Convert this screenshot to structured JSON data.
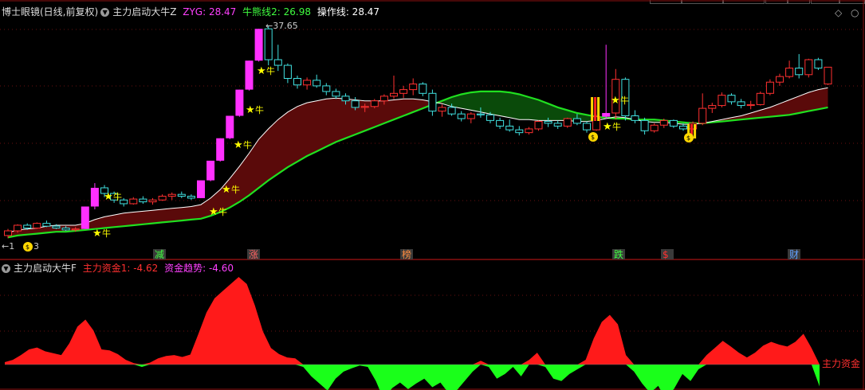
{
  "main_header": {
    "panel_title": "博士眼镜(日线,前复权)",
    "indicator_name": "主力启动大牛Z",
    "zyg_label": "ZYG: 28.47",
    "niuxian_label": "牛熊线2: 26.98",
    "caozuo_label": "操作线: 28.47",
    "colors": {
      "zyg": "#ff40ff",
      "niuxian": "#40ff40",
      "caozuo": "#ffffff"
    }
  },
  "annotations": {
    "high_price": "37.65",
    "left_marker": "←1",
    "left_marker2": "3",
    "bull_char": "牛"
  },
  "event_tags": [
    {
      "name": "减",
      "color": "#40ff40"
    },
    {
      "name": "涨",
      "color": "#ff6060"
    },
    {
      "name": "榜",
      "color": "#ff8c40"
    },
    {
      "name": "跌",
      "color": "#40ff40"
    },
    {
      "name": "$",
      "color": "#ff3030"
    },
    {
      "name": "财",
      "color": "#60a0ff"
    }
  ],
  "sub_header": {
    "indicator_name": "主力启动大牛F",
    "fund_label": "主力资金1: -4.62",
    "trend_label": "资金趋势: -4.60",
    "colors": {
      "fund": "#ff3030",
      "trend": "#ff40ff"
    }
  },
  "sub_right_label": "主力资金",
  "chart_data": {
    "type": "candlestick",
    "price_candles": [
      [
        15.2,
        15.9,
        14.9,
        15.7
      ],
      [
        15.7,
        16.4,
        15.5,
        16.3
      ],
      [
        16.3,
        16.5,
        15.8,
        16.0
      ],
      [
        16.0,
        16.6,
        15.9,
        16.5
      ],
      [
        16.5,
        16.8,
        16.1,
        16.2
      ],
      [
        16.2,
        16.4,
        15.9,
        16.0
      ],
      [
        16.0,
        16.2,
        15.7,
        15.8
      ],
      [
        15.8,
        16.1,
        15.6,
        15.9
      ],
      [
        15.9,
        18.3,
        15.9,
        18.3
      ],
      [
        18.3,
        20.8,
        18.0,
        20.3
      ],
      [
        20.3,
        20.6,
        19.3,
        19.7
      ],
      [
        19.7,
        19.9,
        18.7,
        19.0
      ],
      [
        19.0,
        19.2,
        18.3,
        18.6
      ],
      [
        18.6,
        19.3,
        18.5,
        19.1
      ],
      [
        19.1,
        19.4,
        18.6,
        18.8
      ],
      [
        18.8,
        19.2,
        18.5,
        19.0
      ],
      [
        19.0,
        19.6,
        18.9,
        19.4
      ],
      [
        19.4,
        19.8,
        19.0,
        19.6
      ],
      [
        19.6,
        19.9,
        19.2,
        19.4
      ],
      [
        19.4,
        19.6,
        19.0,
        19.2
      ],
      [
        19.2,
        21.1,
        19.2,
        21.1
      ],
      [
        21.1,
        23.2,
        21.0,
        23.2
      ],
      [
        23.2,
        25.6,
        23.1,
        25.6
      ],
      [
        25.6,
        28.0,
        25.5,
        28.0
      ],
      [
        28.0,
        30.8,
        27.9,
        30.8
      ],
      [
        30.8,
        33.9,
        30.7,
        33.9
      ],
      [
        33.9,
        37.3,
        33.8,
        37.3
      ],
      [
        37.3,
        37.65,
        33.4,
        34.0
      ],
      [
        34.0,
        35.6,
        32.8,
        33.4
      ],
      [
        33.4,
        33.6,
        31.5,
        32.0
      ],
      [
        32.0,
        32.3,
        30.9,
        31.3
      ],
      [
        31.3,
        32.1,
        30.8,
        31.8
      ],
      [
        31.8,
        32.4,
        31.0,
        31.2
      ],
      [
        31.2,
        31.5,
        30.2,
        30.6
      ],
      [
        30.6,
        30.9,
        29.8,
        30.1
      ],
      [
        30.1,
        30.4,
        29.2,
        29.6
      ],
      [
        29.6,
        30.0,
        28.6,
        28.9
      ],
      [
        28.9,
        29.3,
        28.4,
        29.0
      ],
      [
        29.0,
        29.8,
        28.8,
        29.6
      ],
      [
        29.6,
        30.3,
        29.2,
        30.1
      ],
      [
        30.1,
        32.3,
        29.8,
        30.4
      ],
      [
        30.4,
        31.2,
        29.9,
        30.8
      ],
      [
        30.8,
        32.0,
        30.2,
        31.4
      ],
      [
        31.4,
        31.6,
        30.1,
        30.4
      ],
      [
        30.4,
        30.8,
        28.0,
        28.5
      ],
      [
        28.5,
        29.2,
        27.9,
        28.9
      ],
      [
        28.9,
        29.3,
        28.0,
        28.2
      ],
      [
        28.2,
        28.5,
        27.4,
        27.7
      ],
      [
        27.7,
        28.4,
        27.2,
        28.2
      ],
      [
        28.2,
        28.9,
        27.8,
        28.1
      ],
      [
        28.1,
        28.4,
        27.2,
        27.5
      ],
      [
        27.5,
        27.8,
        26.6,
        26.9
      ],
      [
        26.9,
        27.6,
        26.3,
        26.5
      ],
      [
        26.5,
        26.9,
        25.9,
        26.2
      ],
      [
        26.2,
        26.8,
        26.0,
        26.6
      ],
      [
        26.6,
        27.5,
        26.4,
        27.4
      ],
      [
        27.4,
        27.8,
        26.8,
        27.2
      ],
      [
        27.2,
        27.5,
        26.6,
        26.9
      ],
      [
        26.9,
        27.8,
        26.7,
        27.7
      ],
      [
        27.7,
        28.2,
        27.0,
        27.2
      ],
      [
        27.2,
        27.4,
        26.2,
        26.5
      ],
      [
        26.5,
        28.1,
        26.4,
        27.9
      ],
      [
        27.9,
        35.6,
        27.7,
        28.3
      ],
      [
        28.3,
        33.0,
        27.6,
        31.9
      ],
      [
        31.9,
        32.1,
        27.5,
        28.0
      ],
      [
        28.0,
        28.6,
        27.2,
        27.5
      ],
      [
        27.5,
        27.8,
        26.0,
        26.4
      ],
      [
        26.4,
        27.2,
        26.2,
        27.0
      ],
      [
        27.0,
        27.7,
        26.7,
        27.5
      ],
      [
        27.5,
        27.6,
        26.7,
        26.9
      ],
      [
        26.9,
        27.2,
        26.4,
        26.6
      ],
      [
        26.6,
        27.4,
        26.5,
        27.2
      ],
      [
        27.2,
        30.4,
        27.0,
        28.8
      ],
      [
        28.8,
        29.4,
        28.3,
        29.1
      ],
      [
        29.1,
        30.5,
        28.9,
        30.2
      ],
      [
        30.2,
        30.4,
        29.2,
        29.5
      ],
      [
        29.5,
        29.8,
        28.8,
        29.1
      ],
      [
        29.1,
        29.6,
        28.7,
        29.2
      ],
      [
        29.2,
        30.6,
        29.1,
        30.4
      ],
      [
        30.4,
        31.9,
        30.2,
        31.6
      ],
      [
        31.6,
        32.5,
        31.2,
        32.2
      ],
      [
        32.2,
        33.9,
        32.0,
        33.1
      ],
      [
        33.1,
        34.6,
        32.0,
        32.4
      ],
      [
        32.4,
        34.1,
        32.1,
        34.0
      ],
      [
        34.0,
        34.2,
        32.9,
        33.1
      ],
      [
        31.4,
        33.2,
        31.3,
        33.2
      ]
    ],
    "zyg_line": [
      15.5,
      15.8,
      15.9,
      16.0,
      16.2,
      16.3,
      16.3,
      16.3,
      16.5,
      16.9,
      17.2,
      17.4,
      17.6,
      17.7,
      17.8,
      17.9,
      18.0,
      18.1,
      18.2,
      18.3,
      18.5,
      19.2,
      20.1,
      21.3,
      22.6,
      24.0,
      25.5,
      26.6,
      27.6,
      28.4,
      29.0,
      29.4,
      29.6,
      29.8,
      29.9,
      29.8,
      29.7,
      29.6,
      29.6,
      29.6,
      29.7,
      29.8,
      29.8,
      29.7,
      29.5,
      29.3,
      29.0,
      28.8,
      28.6,
      28.4,
      28.2,
      28.0,
      27.8,
      27.6,
      27.6,
      27.5,
      27.5,
      27.5,
      27.5,
      27.4,
      27.4,
      27.5,
      27.7,
      27.9,
      27.8,
      27.6,
      27.4,
      27.3,
      27.3,
      27.2,
      27.1,
      27.1,
      27.2,
      27.4,
      27.6,
      27.8,
      28.0,
      28.3,
      28.6,
      28.9,
      29.3,
      29.7,
      30.1,
      30.5,
      30.8,
      31.0
    ],
    "niuxiong_line": [
      15.0,
      15.2,
      15.3,
      15.4,
      15.5,
      15.6,
      15.6,
      15.7,
      15.8,
      15.9,
      16.0,
      16.1,
      16.2,
      16.3,
      16.4,
      16.5,
      16.6,
      16.7,
      16.8,
      16.9,
      17.0,
      17.3,
      17.7,
      18.2,
      18.8,
      19.5,
      20.3,
      21.1,
      21.8,
      22.5,
      23.1,
      23.7,
      24.2,
      24.7,
      25.2,
      25.6,
      26.0,
      26.4,
      26.8,
      27.2,
      27.6,
      28.0,
      28.4,
      28.8,
      29.2,
      29.6,
      30.0,
      30.3,
      30.5,
      30.6,
      30.6,
      30.6,
      30.5,
      30.3,
      30.0,
      29.7,
      29.3,
      28.9,
      28.6,
      28.3,
      28.1,
      27.9,
      27.8,
      27.7,
      27.7,
      27.6,
      27.6,
      27.6,
      27.5,
      27.4,
      27.3,
      27.2,
      27.2,
      27.3,
      27.4,
      27.5,
      27.6,
      27.7,
      27.8,
      27.9,
      28.0,
      28.1,
      28.3,
      28.5,
      28.7,
      28.9
    ],
    "fund_flow": [
      0.5,
      1.0,
      2.0,
      3.2,
      3.6,
      2.8,
      2.4,
      2.0,
      4.5,
      8.0,
      9.5,
      7.2,
      3.2,
      3.0,
      2.2,
      1.0,
      0.3,
      -0.5,
      0.4,
      1.3,
      1.8,
      2.0,
      1.6,
      2.1,
      6.5,
      11.0,
      14.0,
      15.5,
      17.0,
      18.5,
      17.0,
      12.5,
      7.0,
      3.5,
      2.2,
      1.5,
      1.3,
      -0.5,
      -2.5,
      -4.0,
      -5.5,
      -3.0,
      -1.5,
      -0.8,
      -0.2,
      -0.5,
      -3.5,
      -7.5,
      -5.0,
      -3.8,
      -5.2,
      -4.0,
      -3.0,
      -4.8,
      -3.8,
      -6.0,
      -5.5,
      -3.5,
      -1.5,
      0.8,
      -0.5,
      -3.0,
      -2.0,
      -0.5,
      -2.5,
      1.0,
      2.5,
      -0.5,
      -3.0,
      -3.5,
      -2.0,
      -1.0,
      1.0,
      5.5,
      9.0,
      10.5,
      8.5,
      2.0,
      -1.5,
      -4.0,
      -6.0,
      -4.5,
      -7.5,
      -5.0,
      -2.0,
      -3.5,
      -1.0,
      2.0,
      3.5,
      5.0,
      3.8,
      2.5,
      1.5,
      2.5,
      4.0,
      4.8,
      4.2,
      3.8,
      4.8,
      6.5,
      3.5,
      -4.62
    ]
  }
}
